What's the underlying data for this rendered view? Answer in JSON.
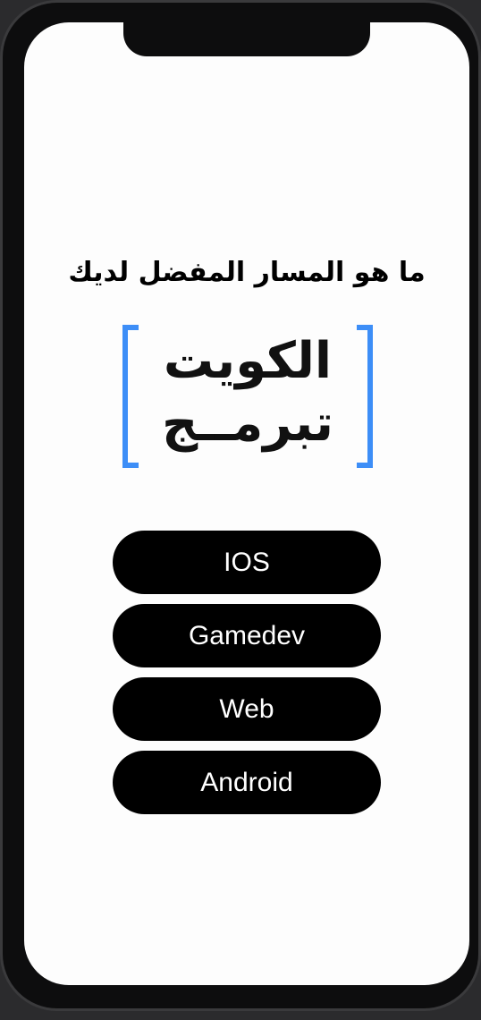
{
  "prompt": {
    "question": "ما هو المسار المفضل لديك"
  },
  "logo": {
    "line1": "الكويت",
    "line2": "تبرمــج",
    "bracket_color": "#3d8ef7"
  },
  "paths": [
    {
      "label": "IOS"
    },
    {
      "label": "Gamedev"
    },
    {
      "label": "Web"
    },
    {
      "label": "Android"
    }
  ]
}
